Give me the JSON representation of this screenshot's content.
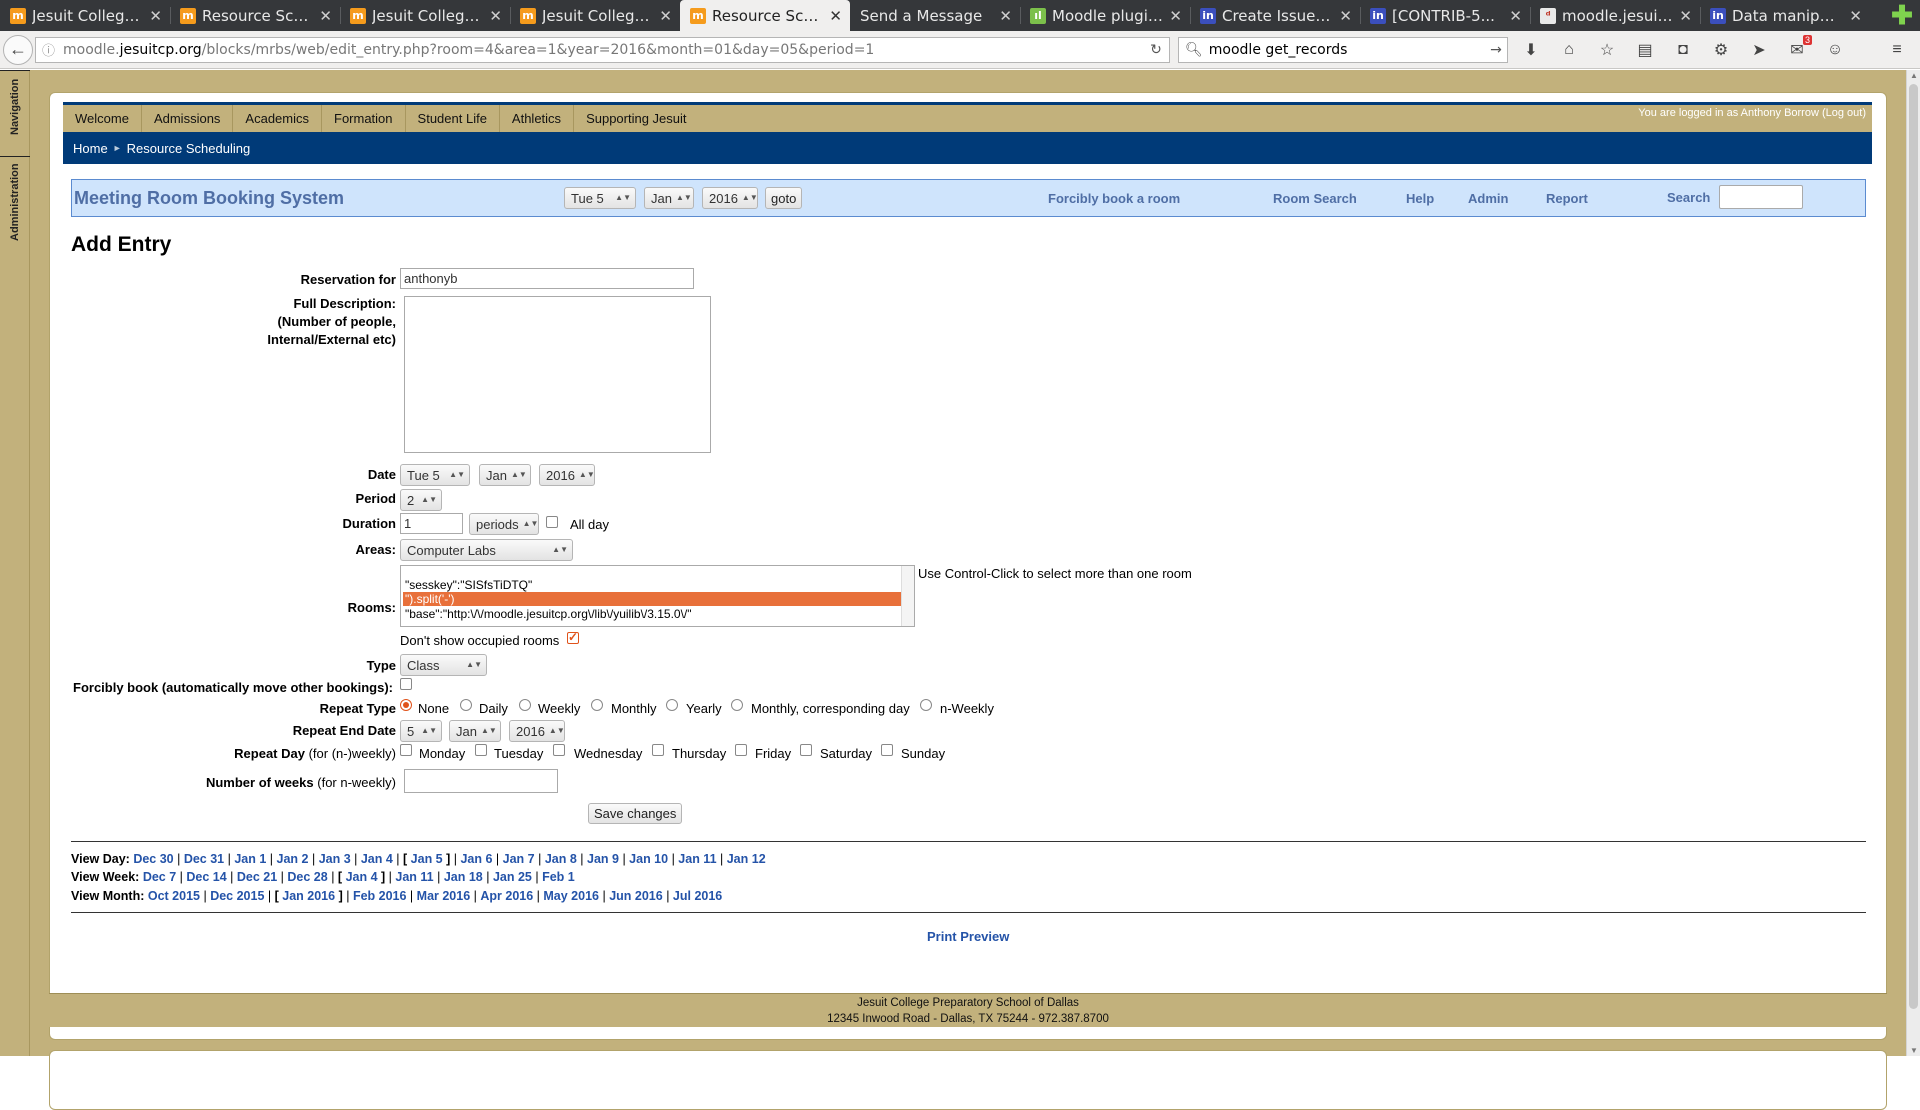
{
  "browser": {
    "tabs": [
      {
        "title": "Jesuit College ...",
        "favicon": "m",
        "active": false
      },
      {
        "title": "Resource Sche...",
        "favicon": "m",
        "active": false
      },
      {
        "title": "Jesuit College ...",
        "favicon": "m",
        "active": false
      },
      {
        "title": "Jesuit College ...",
        "favicon": "m",
        "active": false
      },
      {
        "title": "Resource Sche...",
        "favicon": "m",
        "active": true
      },
      {
        "title": "Send a Message",
        "favicon": "",
        "active": false
      },
      {
        "title": "Moodle plugin...",
        "favicon": "g",
        "active": false
      },
      {
        "title": "Create Issue - ...",
        "favicon": "j",
        "active": false
      },
      {
        "title": "[CONTRIB-5...",
        "favicon": "j",
        "active": false
      },
      {
        "title": "moodle.jesuitc...",
        "favicon": "d",
        "active": false
      },
      {
        "title": "Data manipula...",
        "favicon": "j",
        "active": false
      }
    ],
    "url_prefix": "moodle.",
    "url_domain": "jesuitcp.org",
    "url_path": "/blocks/mrbs/web/edit_entry.php?room=4&area=1&year=2016&month=01&day=05&period=1",
    "search_value": "moodle get_records",
    "notification_count": "3"
  },
  "dock": {
    "navigation": "Navigation",
    "administration": "Administration"
  },
  "header": {
    "nav": [
      "Welcome",
      "Admissions",
      "Academics",
      "Formation",
      "Student Life",
      "Athletics",
      "Supporting Jesuit"
    ],
    "login_info": "You are logged in as Anthony Borrow (Log out)",
    "breadcrumb_home": "Home",
    "breadcrumb_current": "Resource Scheduling"
  },
  "banner": {
    "title": "Meeting Room Booking System",
    "day": "Tue 5",
    "month": "Jan",
    "year": "2016",
    "goto": "goto",
    "forcibly_book": "Forcibly book a room",
    "room_search": "Room Search",
    "help": "Help",
    "admin": "Admin",
    "report": "Report",
    "search_label": "Search"
  },
  "form": {
    "title": "Add Entry",
    "reservation_label": "Reservation for",
    "reservation_value": "anthonyb",
    "description_label_1": "Full Description:",
    "description_label_2": "(Number of people,",
    "description_label_3": "Internal/External etc)",
    "date_label": "Date",
    "date_day": "Tue 5",
    "date_month": "Jan",
    "date_year": "2016",
    "period_label": "Period",
    "period_value": "2",
    "duration_label": "Duration",
    "duration_value": "1",
    "duration_unit": "periods",
    "all_day": "All day",
    "areas_label": "Areas:",
    "areas_value": "Computer Labs",
    "rooms_label": "Rooms:",
    "rooms_options": [
      "\"sesskey\":\"SISfsTiDTQ\"",
      "\").split('-')",
      "\"base\":\"http:\\/\\/moodle.jesuitcp.org\\/lib\\/yuilib\\/3.15.0\\/\""
    ],
    "rooms_hint": "Use Control-Click to select more than one room",
    "dont_show_occupied": "Don't show occupied rooms",
    "type_label": "Type",
    "type_value": "Class",
    "forcibly_label": "Forcibly book (automatically move other bookings):",
    "repeat_type_label": "Repeat Type",
    "repeat_types": [
      "None",
      "Daily",
      "Weekly",
      "Monthly",
      "Yearly",
      "Monthly, corresponding day",
      "n-Weekly"
    ],
    "repeat_end_label": "Repeat End Date",
    "repeat_end_day": "5",
    "repeat_end_month": "Jan",
    "repeat_end_year": "2016",
    "repeat_day_label": "Repeat Day",
    "repeat_day_note": "(for (n-)weekly)",
    "repeat_days": [
      "Monday",
      "Tuesday",
      "Wednesday",
      "Thursday",
      "Friday",
      "Saturday",
      "Sunday"
    ],
    "weeks_label": "Number of weeks",
    "weeks_note": "(for n-weekly)",
    "save": "Save changes"
  },
  "calendar_nav": {
    "view_day_label": "View Day:",
    "days": [
      "Dec 30",
      "Dec 31",
      "Jan 1",
      "Jan 2",
      "Jan 3",
      "Jan 4",
      "Jan 5",
      "Jan 6",
      "Jan 7",
      "Jan 8",
      "Jan 9",
      "Jan 10",
      "Jan 11",
      "Jan 12"
    ],
    "current_day_index": 6,
    "view_week_label": "View Week:",
    "weeks": [
      "Dec 7",
      "Dec 14",
      "Dec 21",
      "Dec 28",
      "Jan 4",
      "Jan 11",
      "Jan 18",
      "Jan 25",
      "Feb 1"
    ],
    "current_week_index": 4,
    "view_month_label": "View Month:",
    "months": [
      "Oct 2015",
      "Dec 2015",
      "Jan 2016",
      "Feb 2016",
      "Mar 2016",
      "Apr 2016",
      "May 2016",
      "Jun 2016",
      "Jul 2016"
    ],
    "current_month_index": 2
  },
  "print_preview": "Print Preview",
  "footer": {
    "line1": "Jesuit College Preparatory School of Dallas",
    "line2": "12345 Inwood Road - Dallas, TX 75244 - 972.387.8700"
  },
  "colors": {
    "gold": "#c2b17c",
    "navy": "#003a78",
    "banner_bg": "#cfe4fc",
    "link": "#2453a8",
    "accent": "#e0531b"
  }
}
